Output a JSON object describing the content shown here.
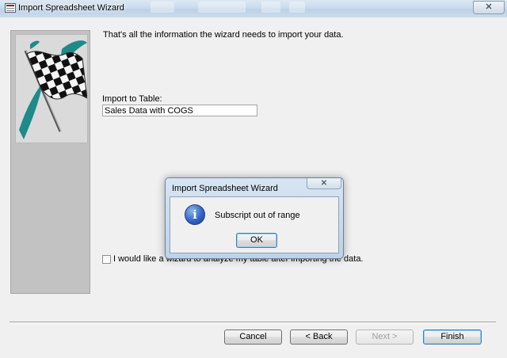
{
  "window": {
    "title": "Import Spreadsheet Wizard",
    "close_glyph": "✕"
  },
  "wizard": {
    "intro": "That's all the information the wizard needs to import your data.",
    "import_to_table": {
      "label": "Import to Table:",
      "value": "Sales Data with COGS"
    },
    "analyze_checkbox": {
      "label": "I would like a wizard to analyze my table after importing the data.",
      "checked": false
    }
  },
  "buttons": {
    "cancel": "Cancel",
    "back": "< Back",
    "next": "Next >",
    "finish": "Finish"
  },
  "message_box": {
    "title": "Import Spreadsheet Wizard",
    "close_glyph": "✕",
    "icon": "info-icon",
    "icon_glyph": "i",
    "message": "Subscript out of range",
    "ok": "OK"
  },
  "colors": {
    "flag_teal": "#1e8a8a",
    "info_blue": "#3266c4",
    "default_button_border": "#3c7fb1"
  }
}
